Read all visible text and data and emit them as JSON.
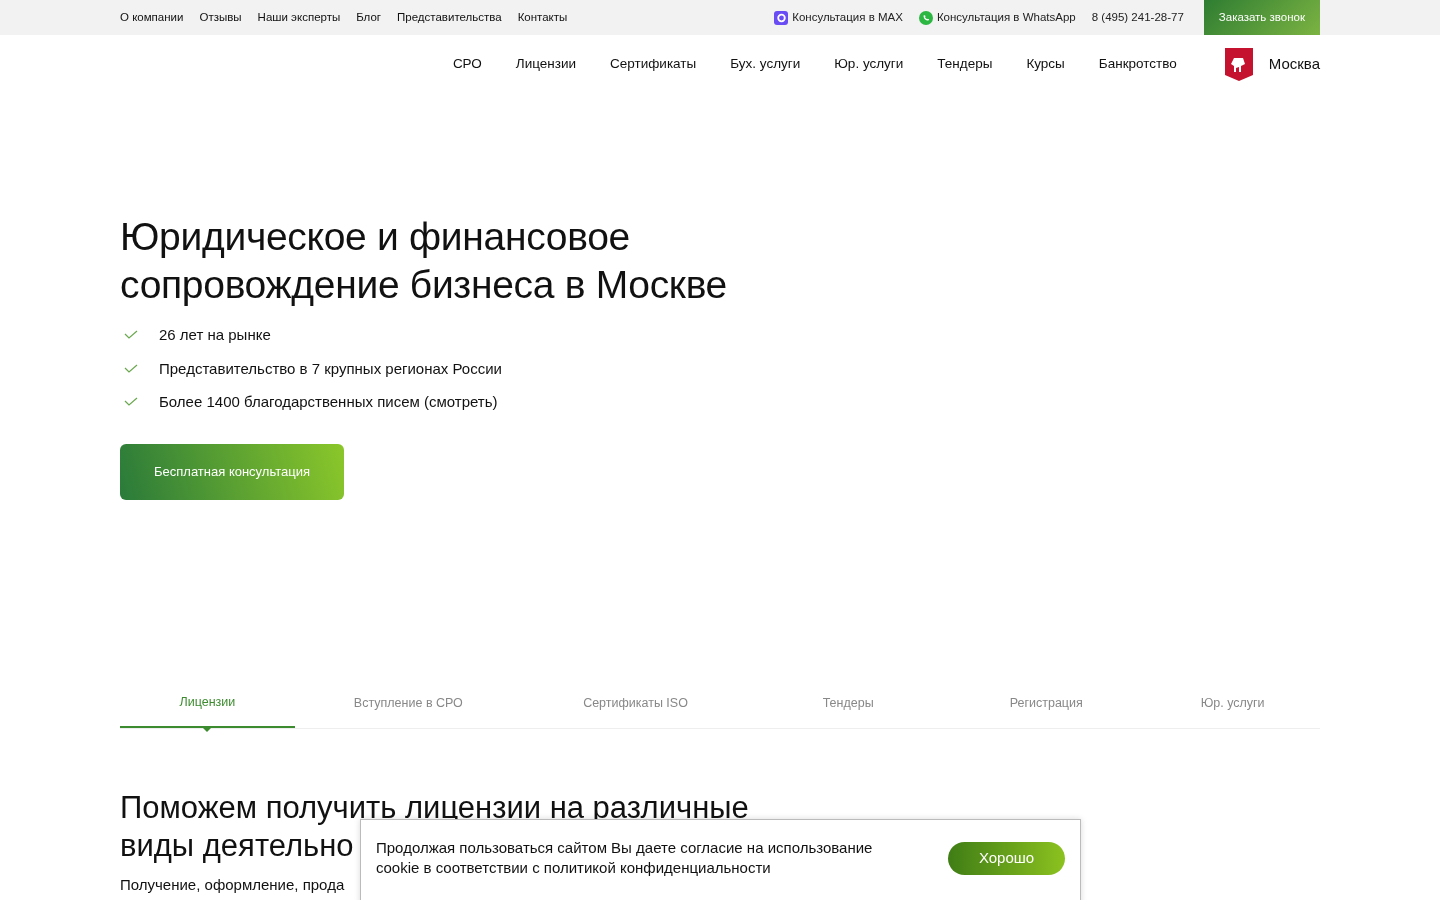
{
  "topbar": {
    "links": [
      "О компании",
      "Отзывы",
      "Наши эксперты",
      "Блог",
      "Представительства",
      "Контакты"
    ],
    "contacts": [
      {
        "kind": "max",
        "label": "Консультация в MAX"
      },
      {
        "kind": "whatsapp",
        "label": "Консультация в WhatsApp"
      },
      {
        "kind": "phone",
        "label": "8 (495) 241-28-77"
      }
    ],
    "callback_button": "Заказать звонок"
  },
  "nav": {
    "items": [
      "СРО",
      "Лицензии",
      "Сертификаты",
      "Бух. услуги",
      "Юр. услуги",
      "Тендеры",
      "Курсы",
      "Банкротство"
    ],
    "city": "Москва"
  },
  "hero": {
    "title": "Юридическое и финансовое сопровождение бизнеса в Москве",
    "points": [
      "26 лет на рынке",
      "Представительство в 7 крупных регионах России",
      "Более 1400 благодарственных писем (смотреть)"
    ],
    "button": "Бесплатная консультация"
  },
  "tabs": [
    {
      "label": "Лицензии",
      "selected": true
    },
    {
      "label": "Вступление в СРО",
      "selected": false
    },
    {
      "label": "Сертификаты ISO",
      "selected": false
    },
    {
      "label": "Тендеры",
      "selected": false
    },
    {
      "label": "Регистрация",
      "selected": false
    },
    {
      "label": "Юр. услуги",
      "selected": false
    }
  ],
  "section": {
    "title_lines": [
      "Поможем получить лицензии на различные",
      "виды деятельно"
    ],
    "subtitle": "Получение, оформление, прода"
  },
  "cookie_banner": {
    "text": "Продолжая пользоваться сайтом Вы даете согласие на использование cookie в соответствии с политикой конфиденциальности",
    "button": "Хорошо"
  }
}
